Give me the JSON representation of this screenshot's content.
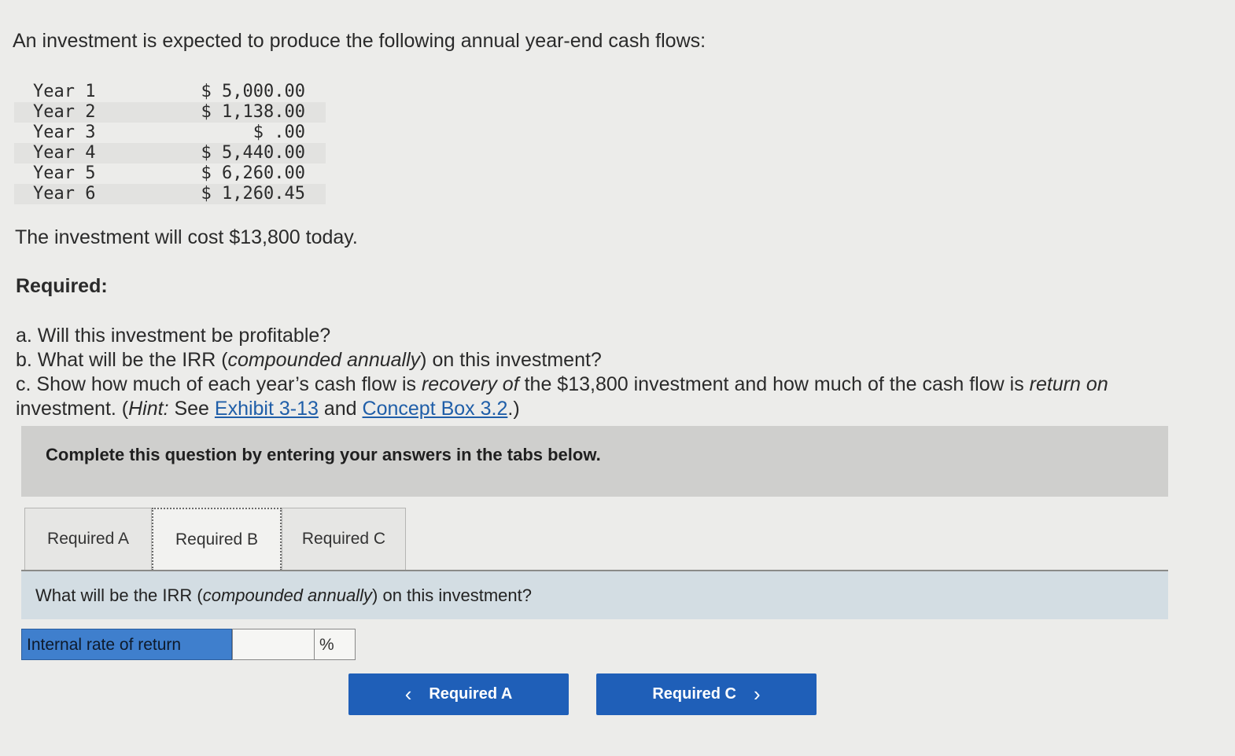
{
  "problem": {
    "intro": "An investment is expected to produce the following annual year-end cash flows:",
    "cash_flows": [
      {
        "year": "Year 1",
        "amount": "$ 5,000.00"
      },
      {
        "year": "Year 2",
        "amount": "$ 1,138.00"
      },
      {
        "year": "Year 3",
        "amount": "$ .00"
      },
      {
        "year": "Year 4",
        "amount": "$ 5,440.00"
      },
      {
        "year": "Year 5",
        "amount": "$ 6,260.00"
      },
      {
        "year": "Year 6",
        "amount": "$ 1,260.45"
      }
    ],
    "cost": "The investment will cost $13,800 today.",
    "required_label": "Required:",
    "q_a": "a. Will this investment be profitable?",
    "q_b_prefix": "b. What will be the IRR (",
    "q_b_em": "compounded annually",
    "q_b_suffix": ") on this investment?",
    "q_c_part1": "c. Show how much of each year’s cash flow is ",
    "q_c_em1": "recovery of",
    "q_c_part2": " the $13,800 investment and how much of the cash flow is ",
    "q_c_em2": "return on",
    "q_c_part3": " investment. (",
    "q_c_hint": "Hint:",
    "q_c_part4": " See ",
    "link1": "Exhibit 3-13",
    "q_c_and": " and ",
    "link2": "Concept Box 3.2",
    "q_c_end": ".)"
  },
  "instructions": "Complete this question by entering your answers in the tabs below.",
  "tabs": [
    {
      "label": "Required A"
    },
    {
      "label": "Required B"
    },
    {
      "label": "Required C"
    }
  ],
  "active_tab": "Required B",
  "panel": {
    "question_prefix": "What will be the IRR (",
    "question_em": "compounded annually",
    "question_suffix": ") on this investment?",
    "answer_label": "Internal rate of return",
    "answer_value": "",
    "answer_unit": "%"
  },
  "nav": {
    "prev_label": "Required A",
    "next_label": "Required C",
    "prev_icon": "chevron-left-icon",
    "next_icon": "chevron-right-icon"
  },
  "colors": {
    "background": "#ececea",
    "link": "#1f5ea8",
    "nav_button": "#1f5fb8",
    "answer_label_bg": "#3f7fcd",
    "panel_bg": "#d3dde3",
    "instruct_bg": "#cfcfcd"
  }
}
